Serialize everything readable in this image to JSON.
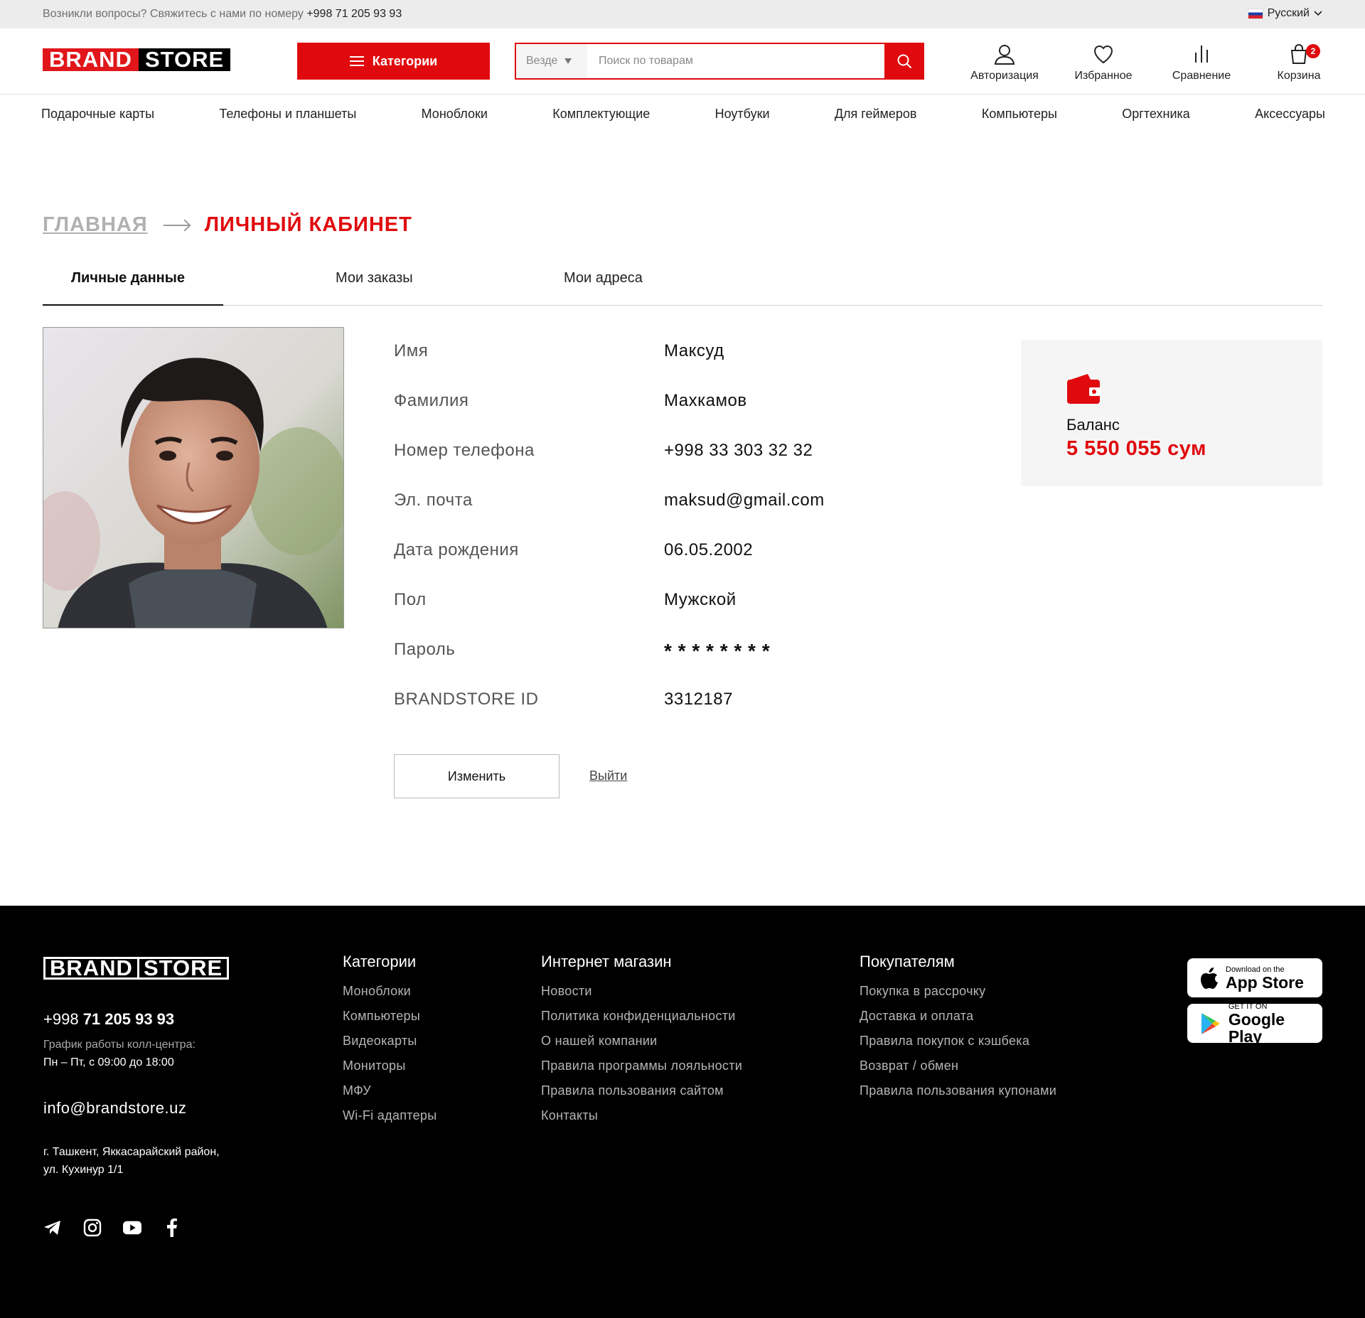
{
  "topbar": {
    "contact_text": "Возникли вопросы? Свяжитесь с нами по номеру",
    "phone": "+998 71 205 93 93",
    "language": "Русский"
  },
  "header": {
    "logo_brand": "BRAND",
    "logo_store": "STORE",
    "categories_label": "Категории",
    "search_scope": "Везде",
    "search_placeholder": "Поиск по товарам",
    "icons": {
      "login": "Авторизация",
      "favorites": "Избранное",
      "compare": "Сравнение",
      "cart": "Корзина",
      "cart_count": "2"
    }
  },
  "nav": [
    "Подарочные карты",
    "Телефоны и планшеты",
    "Моноблоки",
    "Комплектующие",
    "Ноутбуки",
    "Для геймеров",
    "Компьютеры",
    "Оргтехника",
    "Аксессуары"
  ],
  "breadcrumb": {
    "home": "ГЛАВНАЯ",
    "current": "ЛИЧНЫЙ КАБИНЕТ"
  },
  "tabs": [
    "Личные данные",
    "Мои заказы",
    "Мои адреса"
  ],
  "profile": {
    "fields": [
      {
        "label": "Имя",
        "value": "Максуд"
      },
      {
        "label": "Фамилия",
        "value": "Махкамов"
      },
      {
        "label": "Номер телефона",
        "value": "+998 33 303 32 32"
      },
      {
        "label": "Эл. почта",
        "value": "maksud@gmail.com"
      },
      {
        "label": "Дата рождения",
        "value": "06.05.2002"
      },
      {
        "label": "Пол",
        "value": "Мужской"
      },
      {
        "label": "Пароль",
        "value": "* * * * * * * *"
      },
      {
        "label": "BRANDSTORE ID",
        "value": "3312187"
      }
    ],
    "edit_label": "Изменить",
    "logout_label": "Выйти"
  },
  "balance": {
    "label": "Баланс",
    "value": "5 550 055 сум"
  },
  "footer": {
    "phone_prefix": "+998",
    "phone_main": "71 205 93 93",
    "schedule_label": "График работы колл-центра:",
    "schedule": "Пн – Пт, с 09:00 до 18:00",
    "email": "info@brandstore.uz",
    "address": "г. Ташкент, Яккасарайский район, ул. Кухинур 1/1",
    "columns": [
      {
        "title": "Категории",
        "items": [
          "Моноблоки",
          "Компьютеры",
          "Видеокарты",
          "Мониторы",
          "МФУ",
          "Wi-Fi адаптеры"
        ]
      },
      {
        "title": "Интернет магазин",
        "items": [
          "Новости",
          "Политика конфиденциальности",
          "О нашей компании",
          "Правила программы лояльности",
          "Правила пользования сайтом",
          "Контакты"
        ]
      },
      {
        "title": "Покупателям",
        "items": [
          "Покупка в рассрочку",
          "Доставка и оплата",
          "Правила покупок с кэшбека",
          "Возврат / обмен",
          "Правила пользования купонами"
        ]
      }
    ],
    "app_store": {
      "small": "Download on the",
      "big": "App Store"
    },
    "google_play": {
      "small": "GET IT ON",
      "big": "Google Play"
    }
  },
  "colors": {
    "accent": "#e00a0e",
    "footer_bg": "#000000",
    "balance_bg": "#f5f5f5"
  }
}
